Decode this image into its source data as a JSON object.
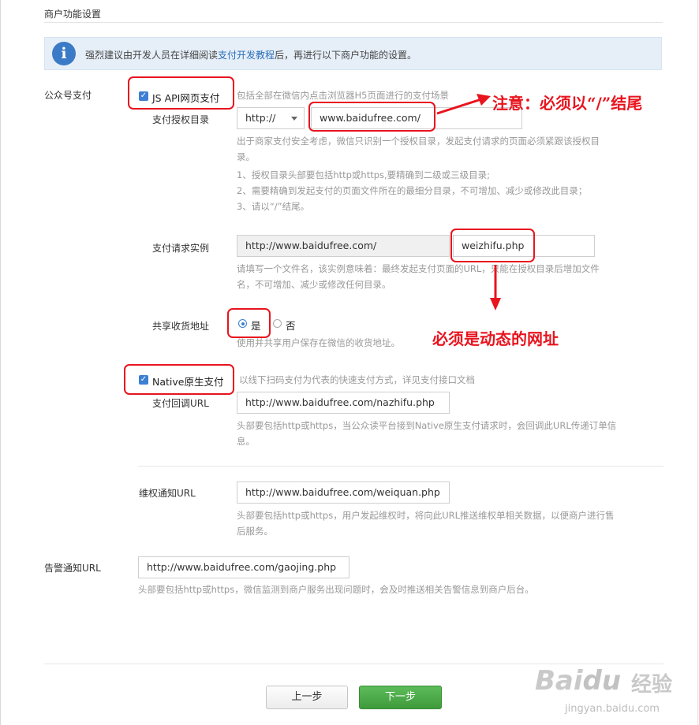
{
  "section_title": "商户功能设置",
  "info": {
    "text_before": "强烈建议由开发人员在详细阅读",
    "link": "支付开发教程",
    "text_after": "后，再进行以下商户功能的设置。"
  },
  "public_pay": {
    "label": "公众号支付",
    "jsapi": {
      "checkbox_label": "JS API网页支付",
      "hint": "包括全部在微信内点击浏览器H5页面进行的支付场景",
      "auth_dir": {
        "label": "支付授权目录",
        "protocol": "http://",
        "value": "www.baidufree.com/",
        "hint_line1": "出于商家支付安全考虑，微信只识别一个授权目录，发起支付请求的页面必须紧跟该授权目",
        "hint_line2": "录。",
        "rule1": "1、授权目录头部要包括http或https,要精确到二级或三级目录;",
        "rule2": "2、需要精确到发起支付的页面文件所在的最细分目录，不可增加、减少或修改此目录；",
        "rule3": "3、请以“/”结尾。"
      },
      "request_example": {
        "label": "支付请求实例",
        "prefix": "http://www.baidufree.com/",
        "value": "weizhifu.php",
        "hint_line1": "请填写一个文件名，该实例意味着：最终发起支付页面的URL，只能在授权目录后增加文件",
        "hint_line2": "名，不可增加、减少或修改任何目录。"
      },
      "share_address": {
        "label": "共享收货地址",
        "yes": "是",
        "no": "否",
        "hint": "使用并共享用户保存在微信的收货地址。"
      }
    },
    "native": {
      "checkbox_label": "Native原生支付",
      "hint": "以线下扫码支付为代表的快速支付方式，详见支付接口文档",
      "callback": {
        "label": "支付回调URL",
        "value": "http://www.baidufree.com/nazhifu.php",
        "hint_line1": "头部要包括http或https，当公众读平台接到Native原生支付请求时，会回调此URL传递订单信",
        "hint_line2": "息。"
      }
    },
    "rights": {
      "label": "维权通知URL",
      "value": "http://www.baidufree.com/weiquan.php",
      "hint_line1": "头部要包括http或https，用户发起维权时，将向此URL推送维权单相关数据，以便商户进行售",
      "hint_line2": "后服务。"
    }
  },
  "alarm": {
    "label": "告警通知URL",
    "value": "http://www.baidufree.com/gaojing.php",
    "hint": "头部要包括http或https，微信监测到商户服务出现问题时，会及时推送相关告警信息到商户后台。"
  },
  "buttons": {
    "prev": "上一步",
    "next": "下一步"
  },
  "annotations": {
    "note1": "注意：必须以“/”结尾",
    "note2": "必须是动态的网址"
  },
  "watermark": {
    "brand": "Bai",
    "paw": "du",
    "service": "经验",
    "url": "jingyan.baidu.com"
  },
  "colors": {
    "accent_blue": "#3d7fd3",
    "annotation_red": "#e8141e",
    "primary_green": "#4cae49",
    "info_bg": "#e6eff8"
  }
}
